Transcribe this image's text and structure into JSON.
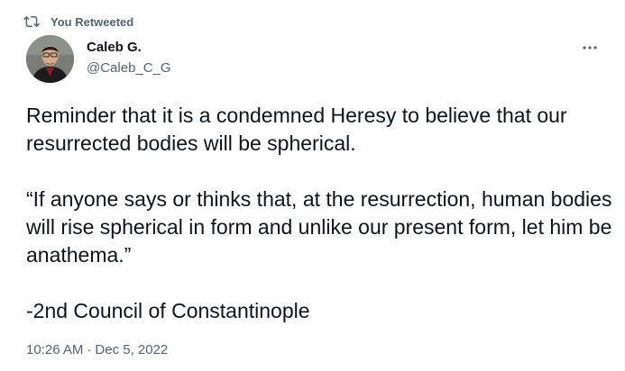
{
  "retweet": {
    "icon": "retweet-icon",
    "label": "You Retweeted"
  },
  "author": {
    "name": "Caleb G.",
    "handle": "@Caleb_C_G",
    "avatar_icon": "user-avatar"
  },
  "more_menu": {
    "icon": "more-horizontal-icon"
  },
  "tweet": {
    "paragraphs": [
      "Reminder that it is a condemned Heresy to believe that our resurrected bodies will be spherical.",
      "“If anyone says or thinks that, at the resurrection, human bodies will rise spherical in form and unlike our present form, let him be anathema.”",
      "-2nd Council of Constantinople"
    ]
  },
  "meta": {
    "time": "10:26 AM",
    "separator": "·",
    "date": "Dec 5, 2022"
  },
  "colors": {
    "text_primary": "#0f1419",
    "text_secondary": "#536471"
  }
}
